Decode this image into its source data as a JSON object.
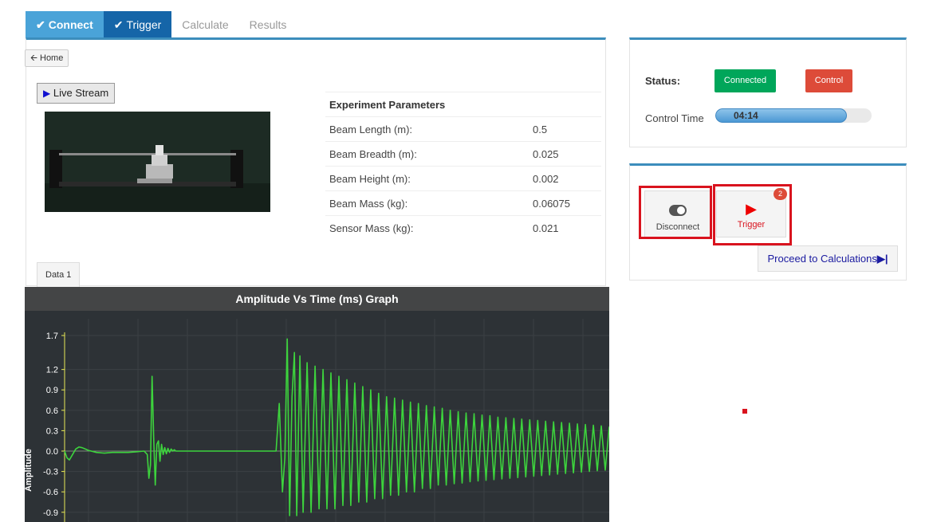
{
  "tabs": [
    {
      "label": "Connect",
      "state": "done"
    },
    {
      "label": "Trigger",
      "state": "active"
    },
    {
      "label": "Calculate",
      "state": "pending"
    },
    {
      "label": "Results",
      "state": "pending"
    }
  ],
  "home_button": "Home",
  "live_stream_button": "Live Stream",
  "parameters": {
    "heading": "Experiment Parameters",
    "rows": [
      {
        "label": "Beam Length (m):",
        "value": "0.5"
      },
      {
        "label": "Beam Breadth (m):",
        "value": "0.025"
      },
      {
        "label": "Beam Height (m):",
        "value": "0.002"
      },
      {
        "label": "Beam Mass (kg):",
        "value": "0.06075"
      },
      {
        "label": "Sensor Mass (kg):",
        "value": "0.021"
      }
    ]
  },
  "data_tab": "Data 1",
  "status": {
    "label": "Status:",
    "connected": "Connected",
    "control": "Control",
    "control_time_label": "Control Time",
    "control_time_value": "04:14",
    "control_time_fraction": 0.84
  },
  "controls": {
    "disconnect": "Disconnect",
    "trigger": "Trigger",
    "trigger_badge": "2",
    "proceed": "Proceed to Calculations"
  },
  "colors": {
    "tab_done": "#4aa3d8",
    "tab_active": "#1565a8",
    "connected": "#00a65a",
    "control": "#dd4b39",
    "highlight": "#d9131e",
    "trace": "#3dd43d"
  },
  "chart_data": {
    "type": "line",
    "title": "Amplitude Vs Time (ms) Graph",
    "ylabel": "Amplitude",
    "xlabel": "",
    "yticks": [
      "1.7",
      "1.2",
      "0.9",
      "0.6",
      "0.3",
      "0.0",
      "-0.3",
      "-0.6",
      "-0.9"
    ],
    "ylim": [
      -1.0,
      1.7
    ],
    "grid": true,
    "series": [
      {
        "x": [
          0,
          3,
          6,
          10,
          14,
          18,
          22,
          26,
          30,
          40,
          50,
          60,
          70,
          80,
          90,
          100,
          104,
          106,
          108,
          110,
          112,
          114,
          116,
          118,
          120,
          122,
          124,
          126,
          128,
          130,
          132,
          134,
          136,
          138,
          140,
          145,
          150,
          160,
          170,
          180,
          190,
          200,
          210,
          220,
          230,
          240,
          250,
          260,
          266,
          270,
          274,
          277,
          280,
          283,
          286,
          289,
          292,
          296,
          300,
          305,
          310,
          315,
          320,
          325,
          330,
          335,
          340,
          345,
          350,
          355,
          360,
          365,
          370,
          375,
          380,
          385,
          390,
          395,
          400,
          405,
          410,
          415,
          420,
          425,
          430,
          435,
          440,
          445,
          450,
          455,
          460,
          465,
          470,
          475,
          480,
          485,
          490,
          495,
          500,
          505,
          510,
          515,
          520,
          525,
          530,
          535,
          540,
          545,
          550,
          555,
          560,
          565,
          570,
          575,
          580,
          585,
          590,
          595,
          600,
          605,
          610,
          615,
          620,
          625,
          630,
          635,
          640,
          645,
          650,
          655,
          660,
          665,
          670,
          675,
          680,
          685
        ],
        "y": [
          0.0,
          -0.1,
          -0.13,
          -0.05,
          0.03,
          0.06,
          0.05,
          0.03,
          0.01,
          -0.02,
          -0.03,
          -0.02,
          -0.02,
          -0.02,
          -0.01,
          0.0,
          -0.05,
          -0.4,
          -0.2,
          1.1,
          0.2,
          -0.5,
          0.1,
          0.15,
          -0.15,
          0.1,
          -0.05,
          0.05,
          -0.04,
          0.04,
          -0.02,
          0.03,
          0.0,
          0.02,
          0.0,
          0.0,
          0.0,
          0.0,
          0.0,
          0.0,
          0.0,
          0.0,
          0.0,
          0.0,
          0.0,
          0.0,
          0.0,
          0.0,
          0.0,
          0.7,
          -0.6,
          -0.1,
          1.65,
          -0.95,
          0.8,
          1.45,
          -0.95,
          1.4,
          -0.9,
          1.3,
          -0.9,
          1.25,
          -0.85,
          1.2,
          -0.85,
          1.15,
          -0.85,
          1.1,
          -0.8,
          1.05,
          -0.8,
          1.0,
          -0.75,
          0.95,
          -0.75,
          0.9,
          -0.7,
          0.85,
          -0.7,
          0.8,
          -0.65,
          0.78,
          -0.65,
          0.75,
          -0.6,
          0.72,
          -0.6,
          0.7,
          -0.55,
          0.67,
          -0.55,
          0.65,
          -0.5,
          0.63,
          -0.5,
          0.6,
          -0.48,
          0.58,
          -0.47,
          0.56,
          -0.45,
          0.55,
          -0.44,
          0.53,
          -0.43,
          0.52,
          -0.42,
          0.5,
          -0.41,
          0.49,
          -0.4,
          0.48,
          -0.39,
          0.47,
          -0.38,
          0.46,
          -0.37,
          0.45,
          -0.36,
          0.44,
          -0.35,
          0.43,
          -0.34,
          0.42,
          -0.33,
          0.41,
          -0.32,
          0.4,
          -0.31,
          0.39,
          -0.3,
          0.38,
          -0.29,
          0.37,
          -0.28,
          0.36
        ]
      }
    ]
  }
}
